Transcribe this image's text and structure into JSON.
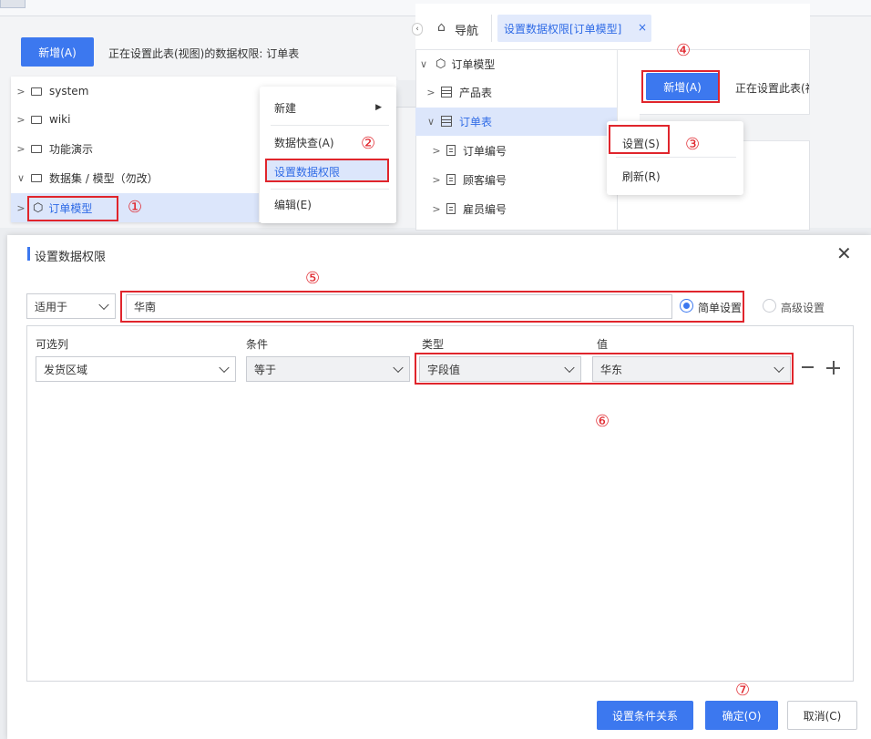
{
  "bg_panel": {
    "new_button": "新增(A)",
    "hint_text": "正在设置此表(视图)的数据权限: 订单表",
    "tree": [
      {
        "label": "system",
        "type": "folder",
        "expand": ">"
      },
      {
        "label": "wiki",
        "type": "folder",
        "expand": ">"
      },
      {
        "label": "功能演示",
        "type": "folder",
        "expand": ">"
      },
      {
        "label": "数据集 / 模型（勿改）",
        "type": "folder",
        "expand": "∨"
      },
      {
        "label": "订单模型",
        "type": "model",
        "expand": ">"
      }
    ],
    "context_menu": [
      "新建",
      "数据快查(A)",
      "设置数据权限",
      "编辑(E)"
    ]
  },
  "nav_panel": {
    "nav_label": "导航",
    "tab_label": "设置数据权限[订单模型]",
    "tree": [
      {
        "label": "订单模型",
        "type": "model",
        "expand": "∨"
      },
      {
        "label": "产品表",
        "type": "table",
        "expand": ">"
      },
      {
        "label": "订单表",
        "type": "table",
        "expand": "∨"
      },
      {
        "label": "订单编号",
        "type": "field",
        "expand": ">"
      },
      {
        "label": "顾客编号",
        "type": "field",
        "expand": ">"
      },
      {
        "label": "雇员编号",
        "type": "field",
        "expand": ">"
      }
    ],
    "new_button": "新增(A)",
    "hint_text": "正在设置此表(视",
    "popup_menu": [
      "设置(S)",
      "刷新(R)"
    ]
  },
  "dialog": {
    "title": "设置数据权限",
    "apply_select": "适用于",
    "name_value": "华南",
    "mode_simple": "简单设置",
    "mode_advanced": "高级设置",
    "columns": [
      "可选列",
      "条件",
      "类型",
      "值"
    ],
    "row": {
      "column": "发货区域",
      "condition": "等于",
      "type": "字段值",
      "value": "华东"
    },
    "buttons": {
      "relation": "设置条件关系",
      "ok": "确定(O)",
      "cancel": "取消(C)"
    }
  },
  "steps": [
    "①",
    "②",
    "③",
    "④",
    "⑤",
    "⑥",
    "⑦"
  ],
  "colors": {
    "accent": "#3c78ef",
    "highlight": "#e0252c",
    "selected_bg": "#dce6fb"
  }
}
